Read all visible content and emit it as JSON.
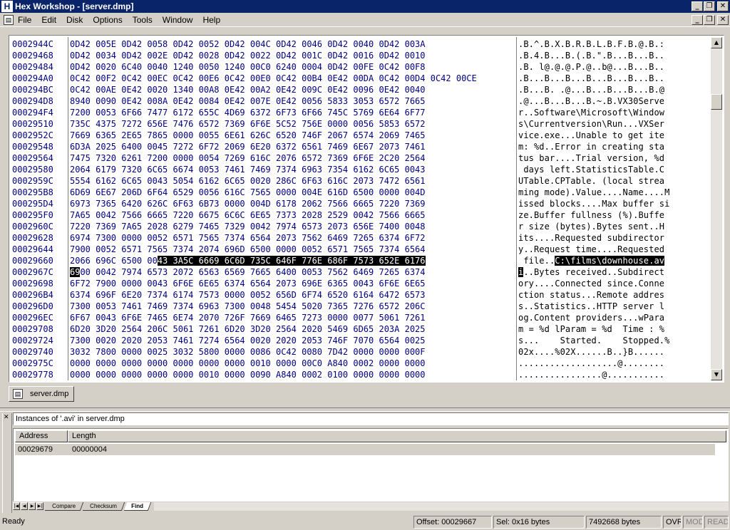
{
  "window": {
    "app_icon_letter": "H",
    "title": "Hex Workshop - [server.dmp]",
    "min_glyph": "_",
    "max_glyph": "❐",
    "close_glyph": "✕"
  },
  "menu": [
    "File",
    "Edit",
    "Disk",
    "Options",
    "Tools",
    "Window",
    "Help"
  ],
  "hex_rows": [
    {
      "addr": "0002944C",
      "hex": "0D42 005E 0D42 0058 0D42 0052 0D42 004C 0D42 0046 0D42 0040 0D42 003A",
      "ascii": ".B.^.B.X.B.R.B.L.B.F.B.@.B.:"
    },
    {
      "addr": "00029468",
      "hex": "0D42 0034 0D42 002E 0D42 0028 0D42 0022 0D42 001C 0D42 0016 0D42 0010",
      "ascii": ".B.4.B...B.(.B.\".B...B...B.."
    },
    {
      "addr": "00029484",
      "hex": "0D42 0020 6C40 0040 1240 0050 1240 00C0 6240 0004 0D42 00FE 0C42 00F8",
      "ascii": ".B. l@.@.@.P.@..b@...B...B.."
    },
    {
      "addr": "000294A0",
      "hex": "0C42 00F2 0C42 00EC 0C42 00E6 0C42 00E0 0C42 00B4 0E42 00DA 0C42 00D4 0C42 00CE",
      "ascii": ".B...B...B...B...B...B...B.."
    },
    {
      "addr": "000294BC",
      "hex": "0C42 00AE 0E42 0020 1340 00A8 0E42 00A2 0E42 009C 0E42 0096 0E42 0040",
      "ascii": ".B...B. .@...B...B...B...B.@"
    },
    {
      "addr": "000294D8",
      "hex": "8940 0090 0E42 008A 0E42 0084 0E42 007E 0E42 0056 5833 3053 6572 7665",
      "ascii": ".@...B...B...B.~.B.VX30Serve"
    },
    {
      "addr": "000294F4",
      "hex": "7200 0053 6F66 7477 6172 655C 4D69 6372 6F73 6F66 745C 5769 6E64 6F77",
      "ascii": "r..Software\\Microsoft\\Window"
    },
    {
      "addr": "00029510",
      "hex": "735C 4375 7272 656E 7476 6572 7369 6F6E 5C52 756E 0000 0056 5853 6572",
      "ascii": "s\\Currentversion\\Run...VXSer"
    },
    {
      "addr": "0002952C",
      "hex": "7669 6365 2E65 7865 0000 0055 6E61 626C 6520 746F 2067 6574 2069 7465",
      "ascii": "vice.exe...Unable to get ite"
    },
    {
      "addr": "00029548",
      "hex": "6D3A 2025 6400 0045 7272 6F72 2069 6E20 6372 6561 7469 6E67 2073 7461",
      "ascii": "m: %d..Error in creating sta"
    },
    {
      "addr": "00029564",
      "hex": "7475 7320 6261 7200 0000 0054 7269 616C 2076 6572 7369 6F6E 2C20 2564",
      "ascii": "tus bar....Trial version, %d"
    },
    {
      "addr": "00029580",
      "hex": "2064 6179 7320 6C65 6674 0053 7461 7469 7374 6963 7354 6162 6C65 0043",
      "ascii": " days left.StatisticsTable.C"
    },
    {
      "addr": "0002959C",
      "hex": "5554 6162 6C65 0043 5054 6162 6C65 0020 286C 6F63 616C 2073 7472 6561",
      "ascii": "UTable.CPTable. (local strea"
    },
    {
      "addr": "000295B8",
      "hex": "6D69 6E67 206D 6F64 6529 0056 616C 7565 0000 004E 616D 6500 0000 004D",
      "ascii": "ming mode).Value....Name....M"
    },
    {
      "addr": "000295D4",
      "hex": "6973 7365 6420 626C 6F63 6B73 0000 004D 6178 2062 7566 6665 7220 7369",
      "ascii": "issed blocks....Max buffer si"
    },
    {
      "addr": "000295F0",
      "hex": "7A65 0042 7566 6665 7220 6675 6C6C 6E65 7373 2028 2529 0042 7566 6665",
      "ascii": "ze.Buffer fullness (%).Buffe"
    },
    {
      "addr": "0002960C",
      "hex": "7220 7369 7A65 2028 6279 7465 7329 0042 7974 6573 2073 656E 7400 0048",
      "ascii": "r size (bytes).Bytes sent..H"
    },
    {
      "addr": "00029628",
      "hex": "6974 7300 0000 0052 6571 7565 7374 6564 2073 7562 6469 7265 6374 6F72",
      "ascii": "its....Requested subdirector"
    },
    {
      "addr": "00029644",
      "hex": "7900 0052 6571 7565 7374 2074 696D 6500 0000 0052 6571 7565 7374 6564",
      "ascii": "y..Request time....Requested"
    },
    {
      "addr": "00029660",
      "hex_pre": "2066 696C 6500 00",
      "hex_hl": "43 3A5C 6669 6C6D 735C 646F 776E 686F 7573 652E 6176",
      "hex_post": "",
      "ascii_pre": " file..",
      "ascii_hl": "C:\\films\\downhouse.av",
      "ascii_post": ""
    },
    {
      "addr": "0002967C",
      "hex_pre": "",
      "hex_hl": "69",
      "hex_post": "00 0042 7974 6573 2072 6563 6569 7665 6400 0053 7562 6469 7265 6374",
      "ascii_pre": "",
      "ascii_hl": "i",
      "ascii_post": "..Bytes received..Subdirect"
    },
    {
      "addr": "00029698",
      "hex": "6F72 7900 0000 0043 6F6E 6E65 6374 6564 2073 696E 6365 0043 6F6E 6E65",
      "ascii": "ory....Connected since.Conne"
    },
    {
      "addr": "000296B4",
      "hex": "6374 696F 6E20 7374 6174 7573 0000 0052 656D 6F74 6520 6164 6472 6573",
      "ascii": "ction status...Remote addres"
    },
    {
      "addr": "000296D0",
      "hex": "7300 0053 7461 7469 7374 6963 7300 0048 5454 5020 7365 7276 6572 206C",
      "ascii": "s..Statistics..HTTP server l"
    },
    {
      "addr": "000296EC",
      "hex": "6F67 0043 6F6E 7465 6E74 2070 726F 7669 6465 7273 0000 0077 5061 7261",
      "ascii": "og.Content providers...wPara"
    },
    {
      "addr": "00029708",
      "hex": "6D20 3D20 2564 206C 5061 7261 6D20 3D20 2564 2020 5469 6D65 203A 2025",
      "ascii": "m = %d lParam = %d  Time : %"
    },
    {
      "addr": "00029724",
      "hex": "7300 0020 2020 2053 7461 7274 6564 0020 2020 2053 746F 7070 6564 0025",
      "ascii": "s...    Started.    Stopped.%"
    },
    {
      "addr": "00029740",
      "hex": "3032 7800 0000 0025 3032 5800 0000 0086 0C42 0080 7D42 0000 0000 000F",
      "ascii": "02x....%02X......B..}B......"
    },
    {
      "addr": "0002975C",
      "hex": "0000 0000 0000 0000 0000 0000 0000 0010 0000 00C0 A840 0002 0000 0000",
      "ascii": "...................@........"
    },
    {
      "addr": "00029778",
      "hex": "0000 0000 0000 0000 0000 0010 0000 0090 A840 0002 0100 0000 0000 0000",
      "ascii": "................@..........."
    }
  ],
  "scroll": {
    "up": "▲",
    "down": "▼"
  },
  "doc_tab": {
    "label": "server.dmp"
  },
  "results": {
    "title": "Instances of '.avi' in server.dmp",
    "headers": {
      "address": "Address",
      "length": "Length"
    },
    "rows": [
      {
        "address": "00029679",
        "length": "00000004"
      }
    ]
  },
  "bottom_tabs": {
    "nav": [
      "|◀",
      "◀",
      "▶",
      "▶|"
    ],
    "tabs": [
      "Compare",
      "Checksum",
      "Find"
    ],
    "active": "Find"
  },
  "status": {
    "ready": "Ready",
    "offset": "Offset: 00029667",
    "selection": "Sel: 0x16 bytes",
    "size": "7492668 bytes",
    "ovr": "OVR",
    "mod": "MOD",
    "read": "READ"
  },
  "colors": {
    "titlebar": "#0a246a",
    "hex_text": "#000080",
    "highlight_bg": "#000000",
    "face": "#d4d0c8"
  }
}
